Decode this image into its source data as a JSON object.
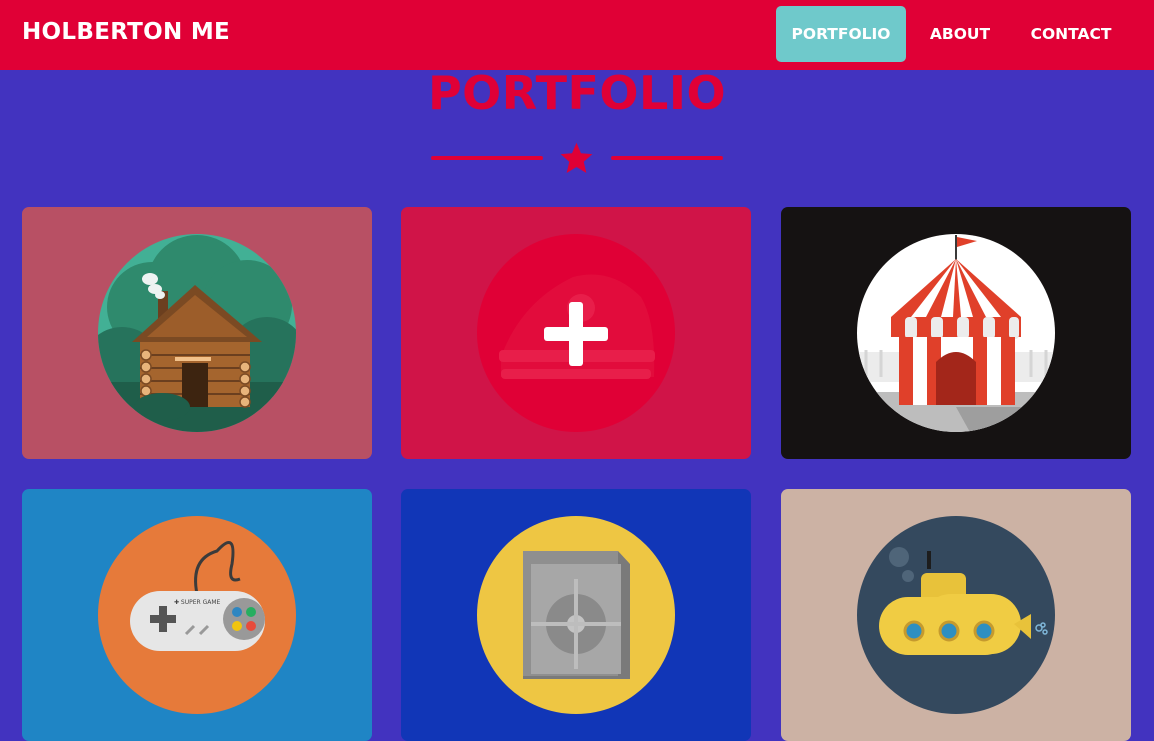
{
  "navbar": {
    "brand": "HOLBERTON ME",
    "items": [
      {
        "label": "PORTFOLIO",
        "active": true
      },
      {
        "label": "ABOUT",
        "active": false
      },
      {
        "label": "CONTACT",
        "active": false
      }
    ]
  },
  "portfolio": {
    "title": "PORTFOLIO",
    "divider_icon": "star-icon",
    "items": [
      {
        "icon": "log-cabin-icon",
        "background": "#b85064",
        "circle": "#42b095"
      },
      {
        "icon": "cake-icon",
        "background": "#d01448",
        "circle": "#e00036",
        "overlay_icon": "plus-icon"
      },
      {
        "icon": "circus-tent-icon",
        "background": "#151212",
        "circle": "#ffffff"
      },
      {
        "icon": "game-controller-icon",
        "background": "#1f85c5",
        "circle": "#e67a3a"
      },
      {
        "icon": "safe-icon",
        "background": "#1136b7",
        "circle": "#eec643"
      },
      {
        "icon": "submarine-icon",
        "background": "#ccb2a4",
        "circle": "#34495e"
      }
    ]
  },
  "colors": {
    "page_background": "#4233bf",
    "primary": "#e00036",
    "nav_active": "#6fc9cb",
    "text_light": "#ffffff"
  }
}
